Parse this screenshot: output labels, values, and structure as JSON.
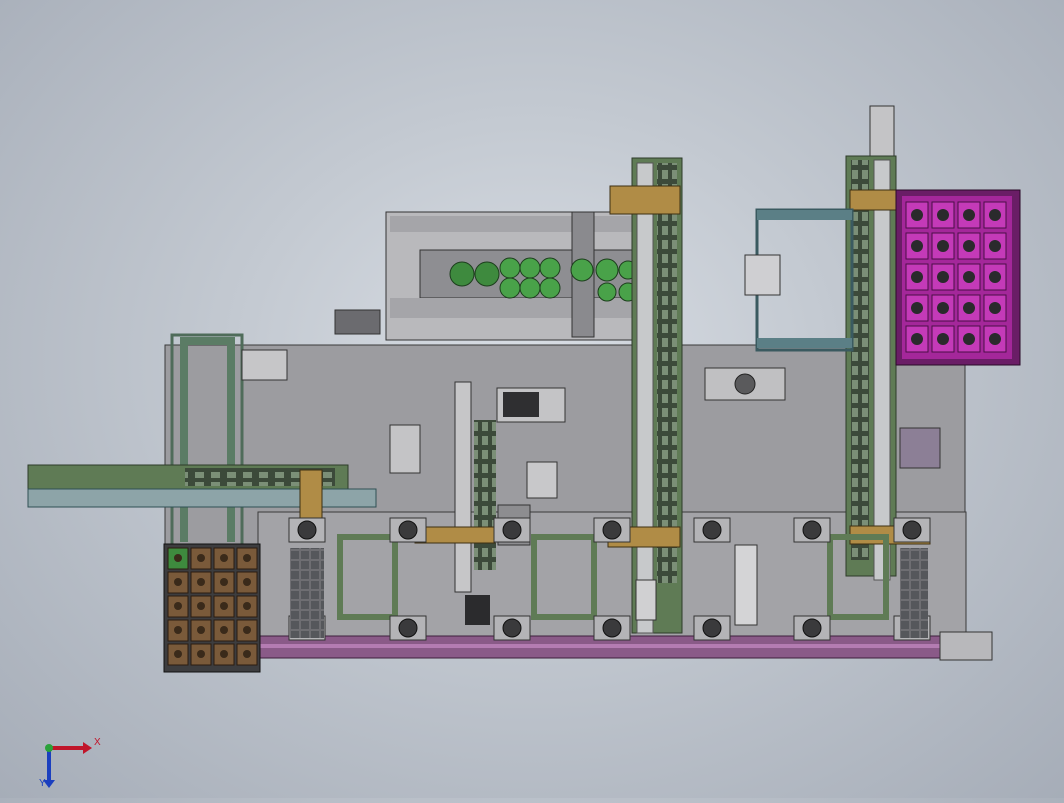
{
  "viewport": {
    "axis_x_label": "X",
    "axis_y_label": "Y"
  },
  "colors": {
    "background_center": "#d8dde4",
    "background_edge": "#a6adb8",
    "base_plate": "#9a9a9e",
    "frame_green": "#5f7b55",
    "frame_magenta": "#8a3f88",
    "tray_purple": "#a4279a",
    "tray_brown": "#7a5a3a",
    "part_green": "#3e8a3e",
    "rail_grey": "#8c8f93"
  },
  "icons": {
    "triad": "coordinate-triad-icon"
  }
}
